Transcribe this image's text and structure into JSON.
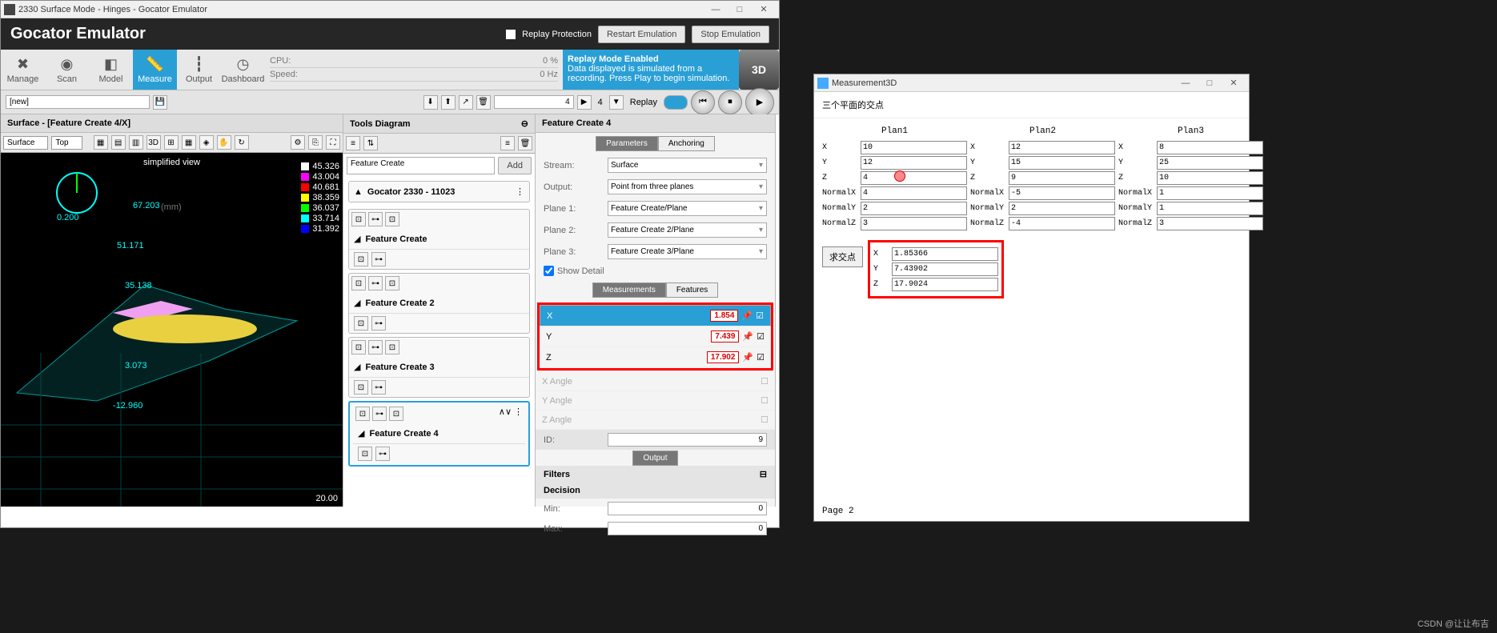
{
  "main_window": {
    "title": "2330 Surface Mode - Hinges - Gocator Emulator",
    "brand": "Gocator Emulator",
    "replay_protection": "Replay Protection",
    "restart_btn": "Restart Emulation",
    "stop_btn": "Stop Emulation"
  },
  "tabs": [
    {
      "label": "Manage",
      "icon": "✖"
    },
    {
      "label": "Scan",
      "icon": "◉"
    },
    {
      "label": "Model",
      "icon": "◧"
    },
    {
      "label": "Measure",
      "icon": "📏"
    },
    {
      "label": "Output",
      "icon": "┇"
    },
    {
      "label": "Dashboard",
      "icon": "◷"
    }
  ],
  "perf": {
    "cpu_lbl": "CPU:",
    "cpu_val": "0 %",
    "speed_lbl": "Speed:",
    "speed_val": "0 Hz"
  },
  "replay_banner": {
    "title": "Replay Mode Enabled",
    "body": "Data displayed is simulated from a recording. Press Play to begin simulation."
  },
  "job_selector": "[new]",
  "frame_count": "4",
  "filter_count": "4",
  "replay_label": "Replay",
  "viewer": {
    "title": "Surface - [Feature Create 4/X]",
    "surface_sel": "Surface",
    "top_sel": "Top",
    "simplified": "simplified view",
    "unit": "(mm)",
    "legend": [
      {
        "c": "#fff",
        "v": "45.326"
      },
      {
        "c": "#f0f",
        "v": "43.004"
      },
      {
        "c": "#f00",
        "v": "40.681"
      },
      {
        "c": "#ff0",
        "v": "38.359"
      },
      {
        "c": "#0f0",
        "v": "36.037"
      },
      {
        "c": "#0ff",
        "v": "33.714"
      },
      {
        "c": "#00f",
        "v": "31.392"
      }
    ],
    "labels": [
      "0.200",
      "67.203",
      "51.171",
      "35.138",
      "3.073",
      "-12.960",
      "20.00"
    ]
  },
  "tools_panel": {
    "title": "Tools Diagram",
    "selector": "Feature Create",
    "add_btn": "Add",
    "sensor": "Gocator 2330 - 11023",
    "items": [
      "Feature Create",
      "Feature Create 2",
      "Feature Create 3",
      "Feature Create 4"
    ]
  },
  "feat_panel": {
    "title": "Feature Create 4",
    "tabs": {
      "params": "Parameters",
      "anchoring": "Anchoring"
    },
    "params": {
      "stream_lbl": "Stream:",
      "stream_val": "Surface",
      "output_lbl": "Output:",
      "output_val": "Point from three planes",
      "p1_lbl": "Plane 1:",
      "p1_val": "Feature Create/Plane",
      "p2_lbl": "Plane 2:",
      "p2_val": "Feature Create 2/Plane",
      "p3_lbl": "Plane 3:",
      "p3_val": "Feature Create 3/Plane",
      "show_detail": "Show Detail"
    },
    "mtabs": {
      "meas": "Measurements",
      "feat": "Features"
    },
    "measurements": [
      {
        "lbl": "X",
        "val": "1.854"
      },
      {
        "lbl": "Y",
        "val": "7.439"
      },
      {
        "lbl": "Z",
        "val": "17.902"
      },
      {
        "lbl": "X Angle",
        "val": ""
      },
      {
        "lbl": "Y Angle",
        "val": ""
      },
      {
        "lbl": "Z Angle",
        "val": ""
      }
    ],
    "id_lbl": "ID:",
    "id_val": "9",
    "output_hdr": "Output",
    "filters": "Filters",
    "decision": "Decision",
    "min_lbl": "Min:",
    "min_val": "0",
    "max_lbl": "Max:",
    "max_val": "0"
  },
  "m3d": {
    "title": "Measurement3D",
    "heading": "三个平面的交点",
    "plans": [
      "Plan1",
      "Plan2",
      "Plan3"
    ],
    "rows": [
      "X",
      "Y",
      "Z",
      "NormalX",
      "NormalY",
      "NormalZ"
    ],
    "data": [
      [
        "10",
        "12",
        "8"
      ],
      [
        "12",
        "15",
        "25"
      ],
      [
        "4",
        "9",
        "10"
      ],
      [
        "4",
        "-5",
        "1"
      ],
      [
        "2",
        "2",
        "1"
      ],
      [
        "3",
        "-4",
        "3"
      ]
    ],
    "calc_btn": "求交点",
    "results": [
      {
        "lbl": "X",
        "val": "1.85366"
      },
      {
        "lbl": "Y",
        "val": "7.43902"
      },
      {
        "lbl": "Z",
        "val": "17.9024"
      }
    ],
    "page": "Page 2"
  },
  "watermark": "CSDN @让让布吉"
}
